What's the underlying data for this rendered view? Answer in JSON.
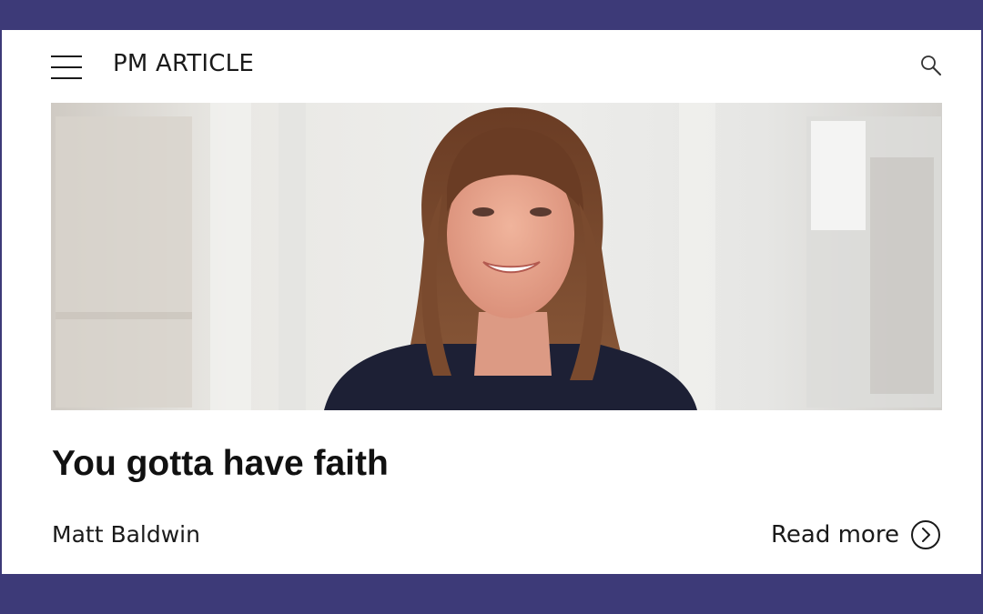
{
  "header": {
    "section_label": "PM ARTICLE",
    "menu_icon": "hamburger-menu-icon",
    "search_icon": "search-icon"
  },
  "hero": {
    "image": "portrait-photo",
    "subject": "smiling woman with shoulder-length brown hair in a bright office"
  },
  "article": {
    "title": "You gotta have faith",
    "author": "Matt Baldwin",
    "read_more_label": "Read more",
    "read_more_icon": "circle-chevron-right-icon"
  },
  "colors": {
    "frame": "#3d3a78",
    "background": "#ffffff",
    "text": "#111111"
  }
}
